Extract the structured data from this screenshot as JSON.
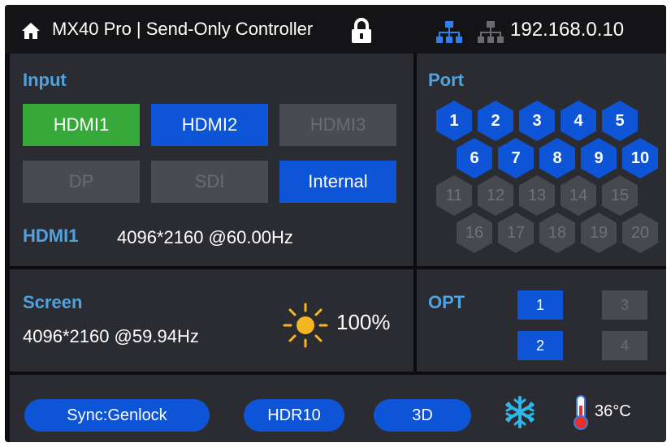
{
  "header": {
    "title": "MX40 Pro | Send-Only Controller",
    "ip": "192.168.0.10",
    "icons": {
      "home": "home-icon",
      "lock": "lock-icon",
      "network_active": "network-icon",
      "network_inactive": "network-icon"
    }
  },
  "input": {
    "title": "Input",
    "buttons": [
      {
        "label": "HDMI1",
        "state": "selected"
      },
      {
        "label": "HDMI2",
        "state": "active"
      },
      {
        "label": "HDMI3",
        "state": "disabled"
      },
      {
        "label": "DP",
        "state": "disabled"
      },
      {
        "label": "SDI",
        "state": "disabled"
      },
      {
        "label": "Internal",
        "state": "active"
      }
    ],
    "source_label": "HDMI1",
    "source_value": "4096*2160 @60.00Hz"
  },
  "port": {
    "title": "Port",
    "ports": [
      {
        "label": "1",
        "active": true
      },
      {
        "label": "2",
        "active": true
      },
      {
        "label": "3",
        "active": true
      },
      {
        "label": "4",
        "active": true
      },
      {
        "label": "5",
        "active": true
      },
      {
        "label": "6",
        "active": true
      },
      {
        "label": "7",
        "active": true
      },
      {
        "label": "8",
        "active": true
      },
      {
        "label": "9",
        "active": true
      },
      {
        "label": "10",
        "active": true
      },
      {
        "label": "11",
        "active": false
      },
      {
        "label": "12",
        "active": false
      },
      {
        "label": "13",
        "active": false
      },
      {
        "label": "14",
        "active": false
      },
      {
        "label": "15",
        "active": false
      },
      {
        "label": "16",
        "active": false
      },
      {
        "label": "17",
        "active": false
      },
      {
        "label": "18",
        "active": false
      },
      {
        "label": "19",
        "active": false
      },
      {
        "label": "20",
        "active": false
      }
    ]
  },
  "screen": {
    "title": "Screen",
    "value": "4096*2160 @59.94Hz",
    "brightness": "100%"
  },
  "opt": {
    "title": "OPT",
    "buttons": [
      {
        "label": "1",
        "active": true
      },
      {
        "label": "2",
        "active": true
      },
      {
        "label": "3",
        "active": false
      },
      {
        "label": "4",
        "active": false
      }
    ]
  },
  "footer": {
    "sync": "Sync:Genlock",
    "hdr": "HDR10",
    "three_d": "3D",
    "temperature": "36°C"
  },
  "colors": {
    "accent_blue": "#0d55d6",
    "selected_green": "#37a83a",
    "title_blue": "#4fa3e0",
    "panel": "#2b2c31",
    "disabled": "#4a4b50"
  }
}
